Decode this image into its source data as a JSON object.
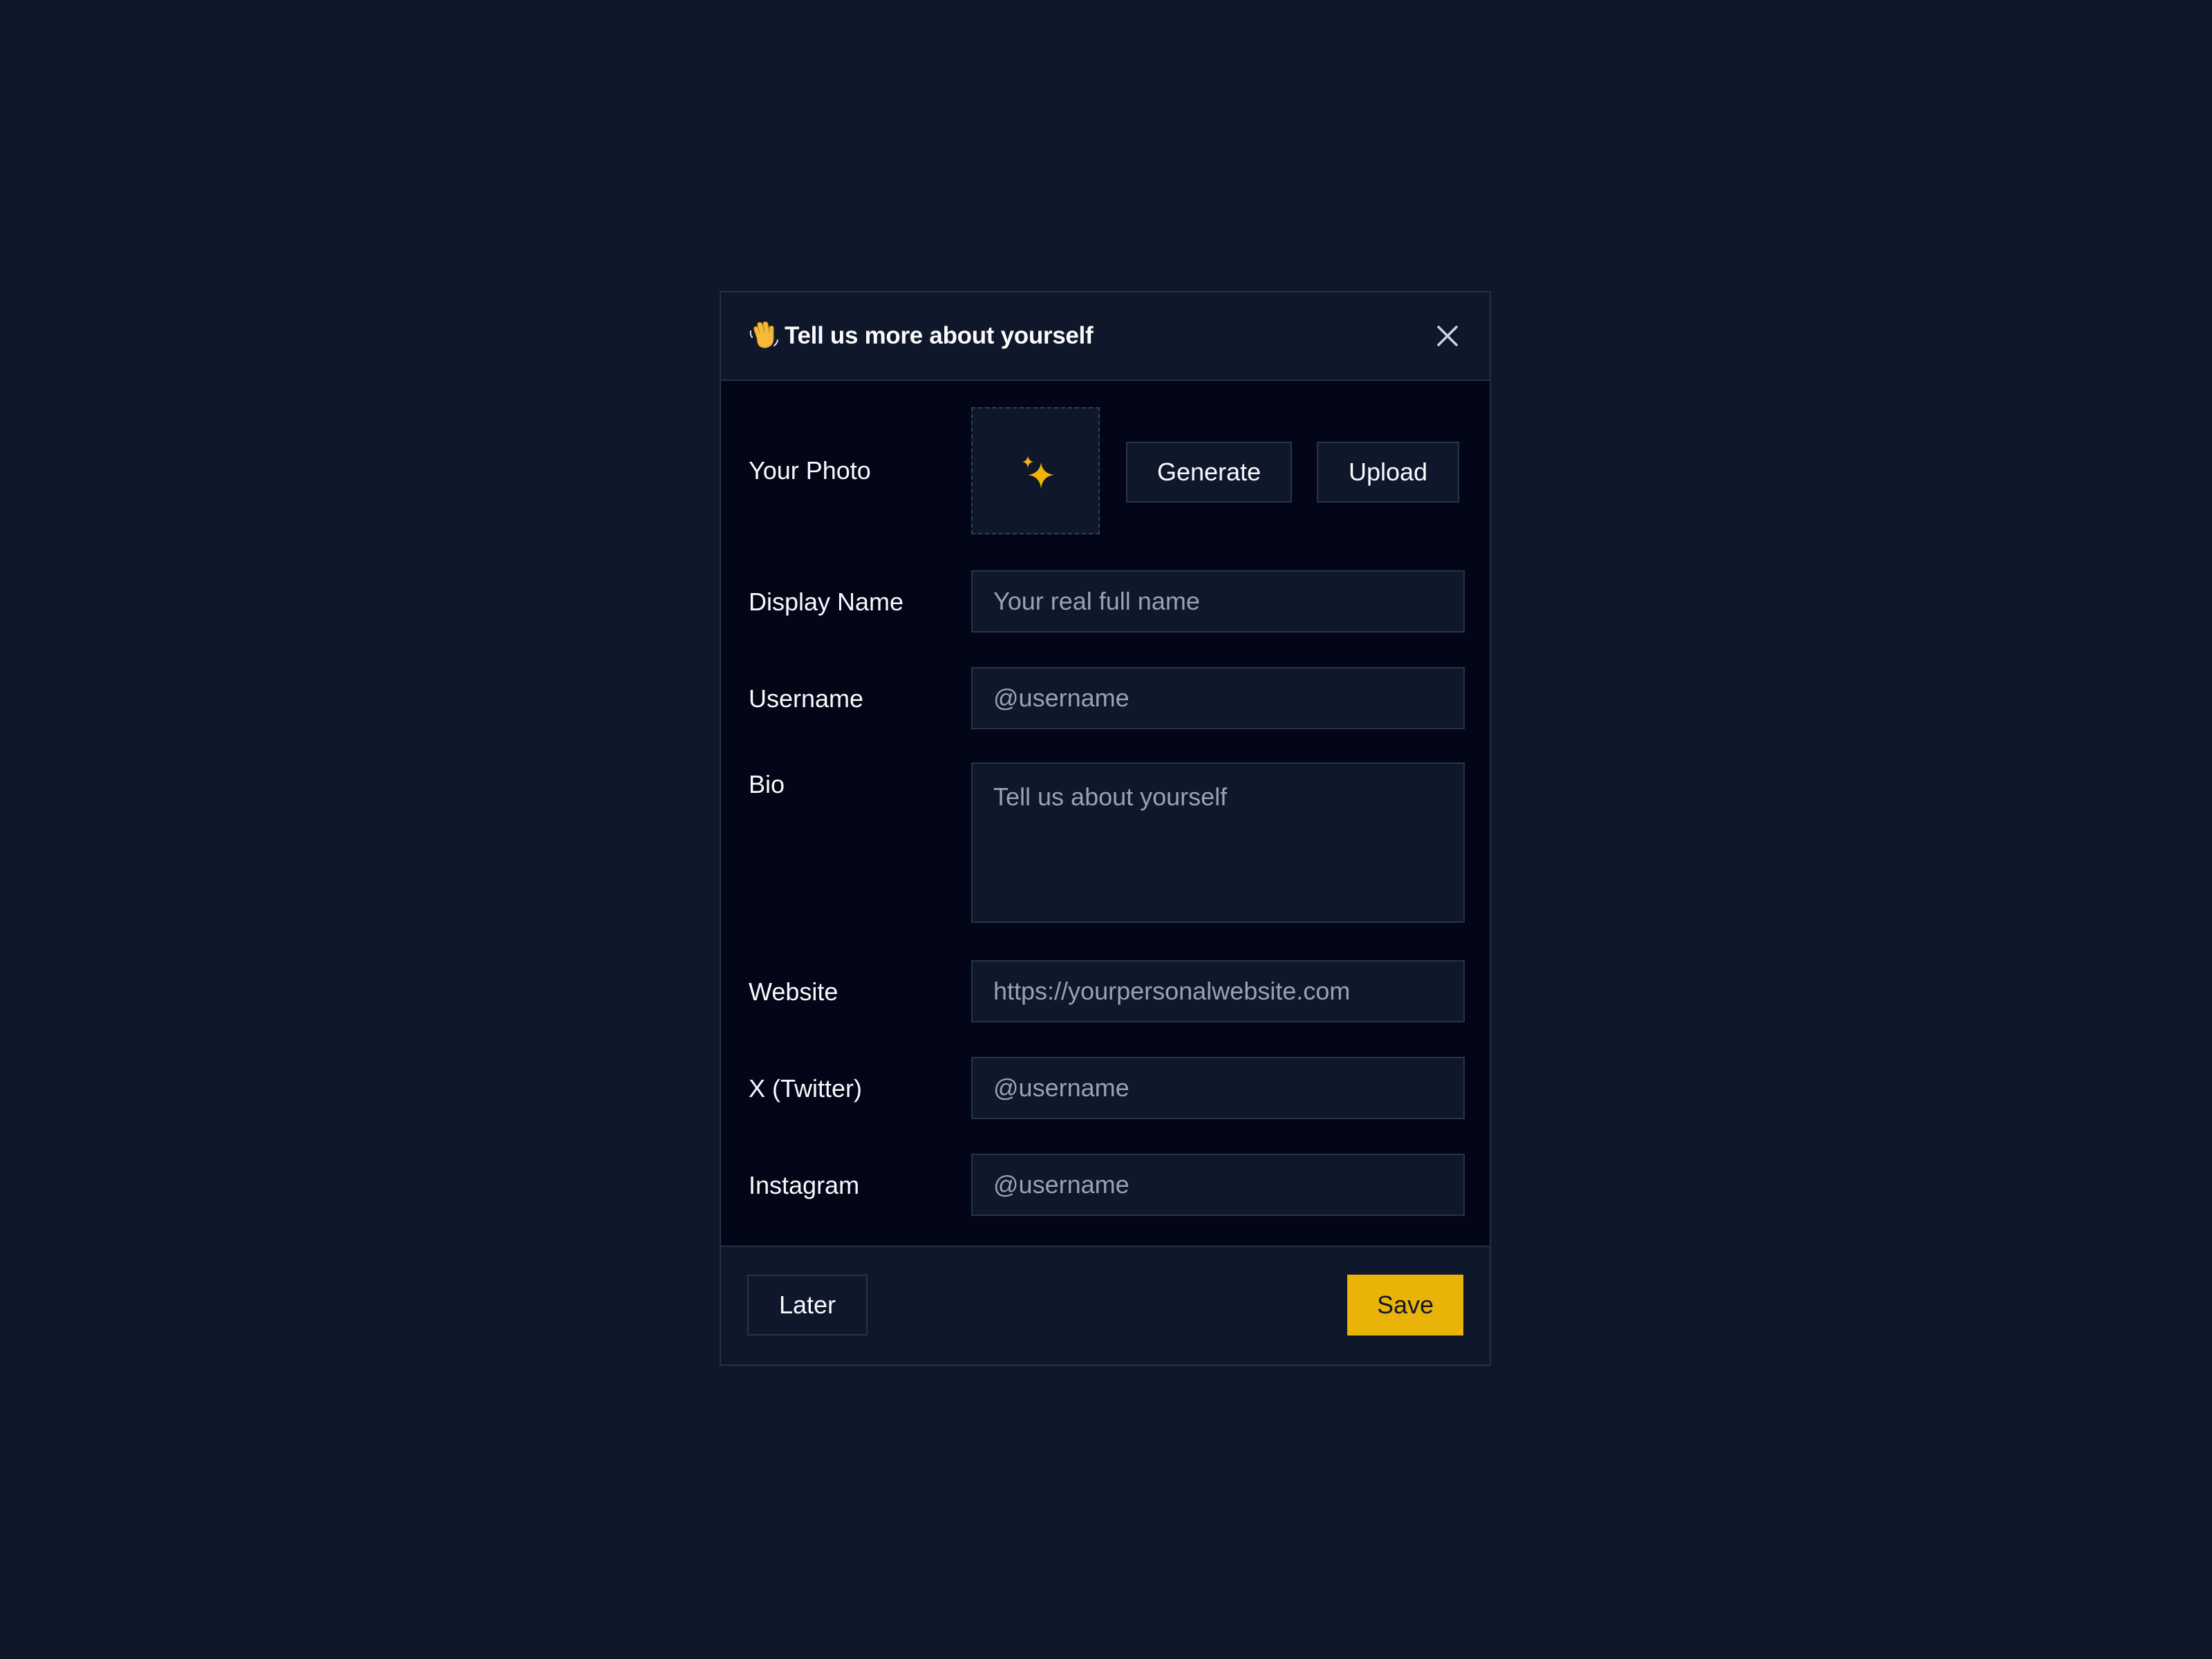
{
  "dialog": {
    "title": "Tell us more about yourself",
    "title_icon": "waving-hand-icon",
    "close_icon": "close-icon"
  },
  "photo": {
    "label": "Your Photo",
    "placeholder_icon": "sparkles-icon",
    "generate_label": "Generate",
    "upload_label": "Upload"
  },
  "fields": {
    "display_name": {
      "label": "Display Name",
      "placeholder": "Your real full name",
      "value": ""
    },
    "username": {
      "label": "Username",
      "placeholder": "@username",
      "value": ""
    },
    "bio": {
      "label": "Bio",
      "placeholder": "Tell us about yourself",
      "value": ""
    },
    "website": {
      "label": "Website",
      "placeholder": "https://yourpersonalwebsite.com",
      "value": ""
    },
    "twitter": {
      "label": "X (Twitter)",
      "placeholder": "@username",
      "value": ""
    },
    "instagram": {
      "label": "Instagram",
      "placeholder": "@username",
      "value": ""
    }
  },
  "footer": {
    "later_label": "Later",
    "save_label": "Save"
  },
  "colors": {
    "accent": "#eab308",
    "background": "#0f172a",
    "panel": "#020617",
    "border": "#253047"
  }
}
